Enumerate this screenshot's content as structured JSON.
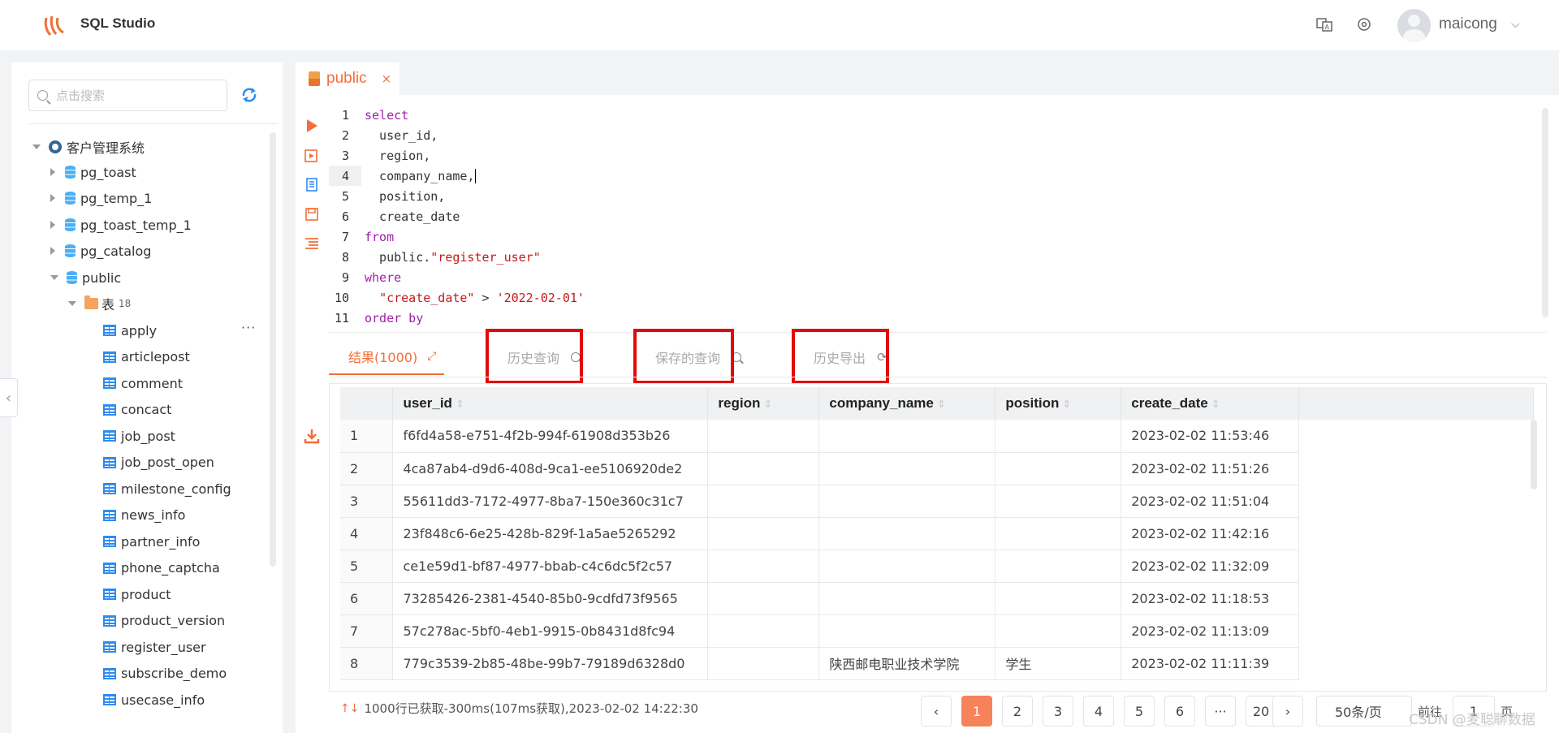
{
  "app": {
    "title": "SQL Studio",
    "brand_color": "#f36e39"
  },
  "header": {
    "username": "maicong",
    "icons": [
      "translate-icon",
      "settings-icon",
      "chevron-down-icon"
    ]
  },
  "sidebar": {
    "search_placeholder": "点击搜索",
    "root": "客户管理系统",
    "schemas": [
      "pg_toast",
      "pg_temp_1",
      "pg_toast_temp_1",
      "pg_catalog",
      "public"
    ],
    "folder": {
      "label": "表",
      "count": "18"
    },
    "tables": [
      "apply",
      "articlepost",
      "comment",
      "concact",
      "job_post",
      "job_post_open",
      "milestone_config",
      "news_info",
      "partner_info",
      "phone_captcha",
      "product",
      "product_version",
      "register_user",
      "subscribe_demo",
      "usecase_info"
    ],
    "more": "···"
  },
  "editor": {
    "tab_label": "public",
    "tab_close": "×",
    "line_numbers": [
      "1",
      "2",
      "3",
      "4",
      "5",
      "6",
      "7",
      "8",
      "9",
      "10",
      "11"
    ]
  },
  "results": {
    "tabs": {
      "result": "结果(1000)",
      "history": "历史查询",
      "saved": "保存的查询",
      "export": "历史导出"
    },
    "columns": [
      "",
      "user_id",
      "region",
      "company_name",
      "position",
      "create_date"
    ],
    "rows": [
      [
        "1",
        "f6fd4a58-e751-4f2b-994f-61908d353b26",
        "",
        "",
        "",
        "2023-02-02 11:53:46"
      ],
      [
        "2",
        "4ca87ab4-d9d6-408d-9ca1-ee5106920de2",
        "",
        "",
        "",
        "2023-02-02 11:51:26"
      ],
      [
        "3",
        "55611dd3-7172-4977-8ba7-150e360c31c7",
        "",
        "",
        "",
        "2023-02-02 11:51:04"
      ],
      [
        "4",
        "23f848c6-6e25-428b-829f-1a5ae5265292",
        "",
        "",
        "",
        "2023-02-02 11:42:16"
      ],
      [
        "5",
        "ce1e59d1-bf87-4977-bbab-c4c6dc5f2c57",
        "",
        "",
        "",
        "2023-02-02 11:32:09"
      ],
      [
        "6",
        "73285426-2381-4540-85b0-9cdfd73f9565",
        "",
        "",
        "",
        "2023-02-02 11:18:53"
      ],
      [
        "7",
        "57c278ac-5bf0-4eb1-9915-0b8431d8fc94",
        "",
        "",
        "",
        "2023-02-02 11:13:09"
      ],
      [
        "8",
        "779c3539-2b85-48be-99b7-79189d6328d0",
        "",
        "陕西邮电职业技术学院",
        "学生",
        "2023-02-02 11:11:39"
      ]
    ],
    "status": "1000行已获取-300ms(107ms获取),2023-02-02 14:22:30"
  },
  "pagination": {
    "prev": "‹",
    "pages": [
      "1",
      "2",
      "3",
      "4",
      "5",
      "6",
      "···",
      "20"
    ],
    "next": "›",
    "page_size": "50条/页",
    "goto_label": "前往",
    "goto_value": "1",
    "goto_suffix": "页"
  },
  "watermark": "CSDN @麦聪聊数据"
}
